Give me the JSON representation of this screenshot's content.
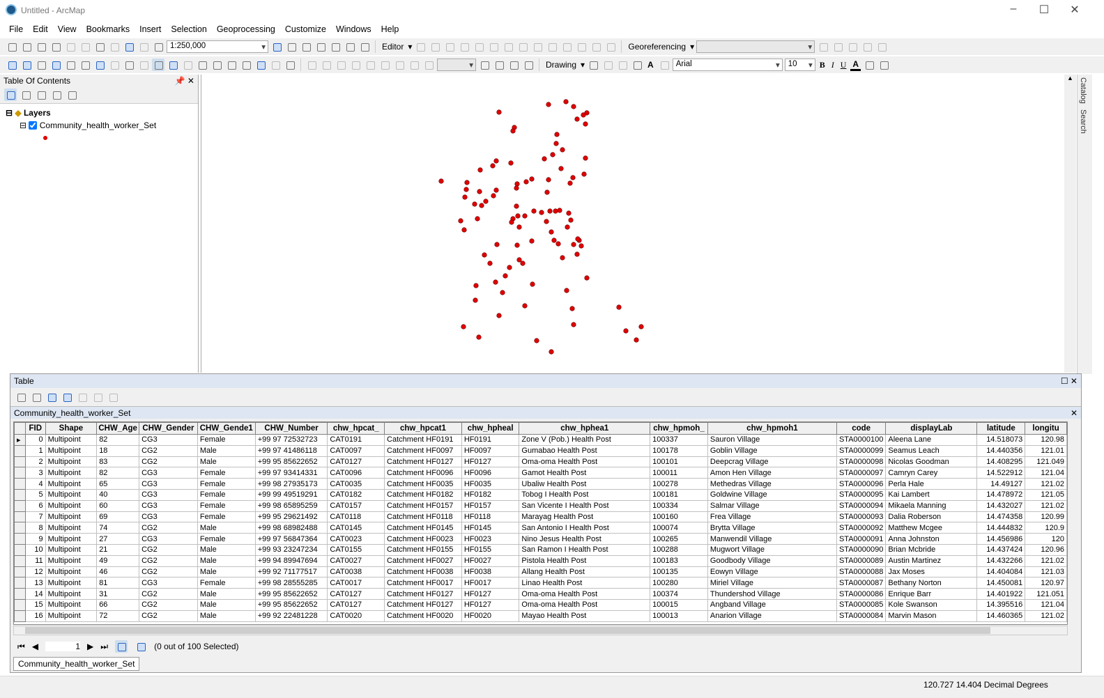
{
  "window": {
    "title": "Untitled - ArcMap"
  },
  "menu": [
    "File",
    "Edit",
    "View",
    "Bookmarks",
    "Insert",
    "Selection",
    "Geoprocessing",
    "Customize",
    "Windows",
    "Help"
  ],
  "toolbar": {
    "scale": "1:250,000",
    "editor": "Editor",
    "georeferencing": "Georeferencing",
    "drawing": "Drawing",
    "font": "Arial",
    "font_size": "10",
    "bold": "B",
    "italic": "I",
    "underline": "U",
    "font_color": "A"
  },
  "toc": {
    "title": "Table Of Contents",
    "layers_label": "Layers",
    "layer_name": "Community_health_worker_Set",
    "layer_checked": true,
    "symbol_color": "#e00000"
  },
  "side_tabs": [
    "Catalog",
    "Search"
  ],
  "table": {
    "title": "Table",
    "layer_tab": "Community_health_worker_Set",
    "columns": [
      "FID",
      "Shape",
      "CHW_Age",
      "CHW_Gender",
      "CHW_Gende1",
      "CHW_Number",
      "chw_hpcat_",
      "chw_hpcat1",
      "chw_hpheal",
      "chw_hphea1",
      "chw_hpmoh_",
      "chw_hpmoh1",
      "code",
      "displayLab",
      "latitude",
      "longitu"
    ],
    "rows": [
      [
        "0",
        "Multipoint",
        "82",
        "CG3",
        "Female",
        "+99 97 72532723",
        "CAT0191",
        "Catchment HF0191",
        "HF0191",
        "Zone V (Pob.) Health Post",
        "100337",
        "Sauron Village",
        "STA0000100",
        "Aleena Lane",
        "14.518073",
        "120.98"
      ],
      [
        "1",
        "Multipoint",
        "18",
        "CG2",
        "Male",
        "+99 97 41486118",
        "CAT0097",
        "Catchment HF0097",
        "HF0097",
        "Gumabao Health Post",
        "100178",
        "Goblin Village",
        "STA0000099",
        "Seamus Leach",
        "14.440356",
        "121.01"
      ],
      [
        "2",
        "Multipoint",
        "83",
        "CG2",
        "Male",
        "+99 95 85622652",
        "CAT0127",
        "Catchment HF0127",
        "HF0127",
        "Oma-oma Health Post",
        "100101",
        "Deepcrag Village",
        "STA0000098",
        "Nicolas Goodman",
        "14.408295",
        "121.049"
      ],
      [
        "3",
        "Multipoint",
        "82",
        "CG3",
        "Female",
        "+99 97 93414331",
        "CAT0096",
        "Catchment HF0096",
        "HF0096",
        "Gamot Health Post",
        "100011",
        "Amon Hen Village",
        "STA0000097",
        "Camryn Carey",
        "14.522912",
        "121.04"
      ],
      [
        "4",
        "Multipoint",
        "65",
        "CG3",
        "Female",
        "+99 98 27935173",
        "CAT0035",
        "Catchment HF0035",
        "HF0035",
        "Ubaliw Health Post",
        "100278",
        "Methedras Village",
        "STA0000096",
        "Perla Hale",
        "14.49127",
        "121.02"
      ],
      [
        "5",
        "Multipoint",
        "40",
        "CG3",
        "Female",
        "+99 99 49519291",
        "CAT0182",
        "Catchment HF0182",
        "HF0182",
        "Tobog I Health Post",
        "100181",
        "Goldwine Village",
        "STA0000095",
        "Kai Lambert",
        "14.478972",
        "121.05"
      ],
      [
        "6",
        "Multipoint",
        "60",
        "CG3",
        "Female",
        "+99 98 65895259",
        "CAT0157",
        "Catchment HF0157",
        "HF0157",
        "San Vicente I Health Post",
        "100334",
        "Salmar Village",
        "STA0000094",
        "Mikaela Manning",
        "14.432027",
        "121.02"
      ],
      [
        "7",
        "Multipoint",
        "69",
        "CG3",
        "Female",
        "+99 95 29621492",
        "CAT0118",
        "Catchment HF0118",
        "HF0118",
        "Marayag Health Post",
        "100160",
        "Frea Village",
        "STA0000093",
        "Dalia Roberson",
        "14.474358",
        "120.99"
      ],
      [
        "8",
        "Multipoint",
        "74",
        "CG2",
        "Male",
        "+99 98 68982488",
        "CAT0145",
        "Catchment HF0145",
        "HF0145",
        "San Antonio I Health Post",
        "100074",
        "Brytta Village",
        "STA0000092",
        "Matthew Mcgee",
        "14.444832",
        "120.9"
      ],
      [
        "9",
        "Multipoint",
        "27",
        "CG3",
        "Female",
        "+99 97 56847364",
        "CAT0023",
        "Catchment HF0023",
        "HF0023",
        "Nino Jesus Health Post",
        "100265",
        "Manwendil Village",
        "STA0000091",
        "Anna Johnston",
        "14.456986",
        "120"
      ],
      [
        "10",
        "Multipoint",
        "21",
        "CG2",
        "Male",
        "+99 93 23247234",
        "CAT0155",
        "Catchment HF0155",
        "HF0155",
        "San Ramon I Health Post",
        "100288",
        "Mugwort Village",
        "STA0000090",
        "Brian Mcbride",
        "14.437424",
        "120.96"
      ],
      [
        "11",
        "Multipoint",
        "49",
        "CG2",
        "Male",
        "+99 94 89947694",
        "CAT0027",
        "Catchment HF0027",
        "HF0027",
        "Pistola Health Post",
        "100183",
        "Goodbody Village",
        "STA0000089",
        "Austin Martinez",
        "14.432266",
        "121.02"
      ],
      [
        "12",
        "Multipoint",
        "46",
        "CG2",
        "Male",
        "+99 92 71177517",
        "CAT0038",
        "Catchment HF0038",
        "HF0038",
        "Allang Health Post",
        "100135",
        "Eowyn Village",
        "STA0000088",
        "Jax Moses",
        "14.404084",
        "121.03"
      ],
      [
        "13",
        "Multipoint",
        "81",
        "CG3",
        "Female",
        "+99 98 28555285",
        "CAT0017",
        "Catchment HF0017",
        "HF0017",
        "Linao Health Post",
        "100280",
        "Miriel Village",
        "STA0000087",
        "Bethany Norton",
        "14.450081",
        "120.97"
      ],
      [
        "14",
        "Multipoint",
        "31",
        "CG2",
        "Male",
        "+99 95 85622652",
        "CAT0127",
        "Catchment HF0127",
        "HF0127",
        "Oma-oma Health Post",
        "100374",
        "Thundershod Village",
        "STA0000086",
        "Enrique Barr",
        "14.401922",
        "121.051"
      ],
      [
        "15",
        "Multipoint",
        "66",
        "CG2",
        "Male",
        "+99 95 85622652",
        "CAT0127",
        "Catchment HF0127",
        "HF0127",
        "Oma-oma Health Post",
        "100015",
        "Angband Village",
        "STA0000085",
        "Kole Swanson",
        "14.395516",
        "121.04"
      ],
      [
        "16",
        "Multipoint",
        "72",
        "CG2",
        "Male",
        "+99 92 22481228",
        "CAT0020",
        "Catchment HF0020",
        "HF0020",
        "Mayao Health Post",
        "100013",
        "Anarion Village",
        "STA0000084",
        "Marvin Mason",
        "14.460365",
        "121.02"
      ]
    ],
    "current_record": "1",
    "selection_status": "(0 out of 100 Selected)",
    "bottom_tab": "Community_health_worker_Set"
  },
  "status": {
    "coords": "120.727  14.404 Decimal Degrees"
  }
}
